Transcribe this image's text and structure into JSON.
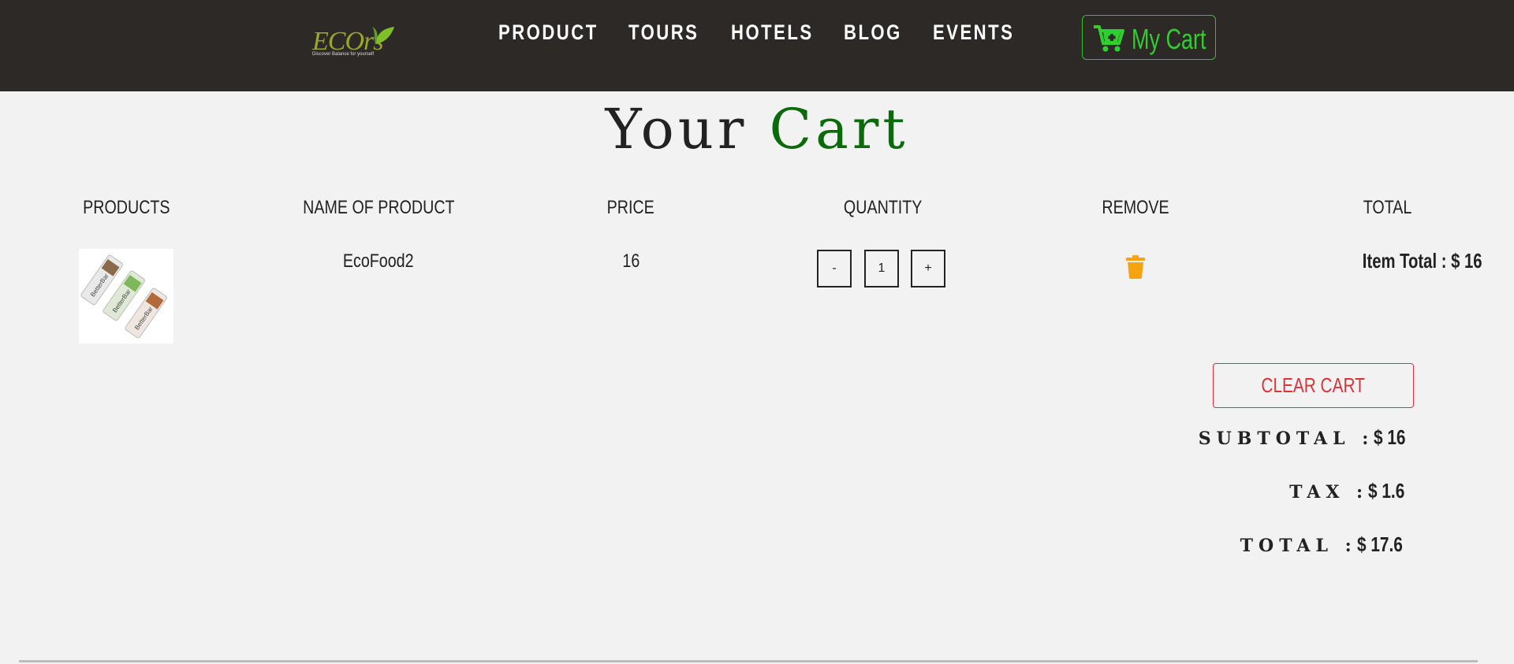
{
  "brand": {
    "logo_text": "ECOrs",
    "tagline": "Discover Balance for yourself"
  },
  "nav": {
    "links": [
      {
        "label": "PRODUCT"
      },
      {
        "label": "TOURS"
      },
      {
        "label": "HOTELS"
      },
      {
        "label": "BLOG"
      },
      {
        "label": "EVENTS"
      }
    ],
    "cart_label": "My Cart"
  },
  "title": {
    "part1": "Your",
    "part2": "Cart"
  },
  "table": {
    "headers": [
      "PRODUCTS",
      "NAME OF PRODUCT",
      "PRICE",
      "QUANTITY",
      "REMOVE",
      "TOTAL"
    ],
    "rows": [
      {
        "image": "product-image",
        "name": "EcoFood2",
        "price": "16",
        "decrement": "-",
        "quantity": "1",
        "increment": "+",
        "item_total": "Item Total : $ 16"
      }
    ]
  },
  "summary": {
    "clear_label": "CLEAR CART",
    "subtotal_label": "SUBTOTAL :",
    "subtotal_value": "$ 16",
    "tax_label": "TAX :",
    "tax_value": "$ 1.6",
    "total_label": "TOTAL :",
    "total_value": "$ 17.6"
  },
  "colors": {
    "navbar": "#2d2927",
    "accent_green": "#2fcf2f",
    "title_green": "#0b6b0b",
    "danger": "#d9343d",
    "trash": "#f5a30f",
    "background": "#f2f2f2"
  }
}
